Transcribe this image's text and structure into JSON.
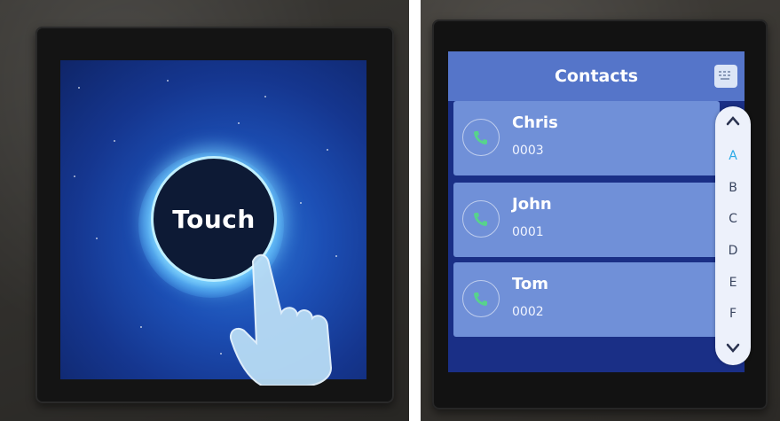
{
  "left_panel": {
    "touch_label": "Touch"
  },
  "right_panel": {
    "header": {
      "title": "Contacts",
      "keypad_icon": "keypad-icon"
    },
    "contacts": [
      {
        "name": "Chris",
        "number": "0003",
        "icon": "phone-icon"
      },
      {
        "name": "John",
        "number": "0001",
        "icon": "phone-icon"
      },
      {
        "name": "Tom",
        "number": "0002",
        "icon": "phone-icon"
      }
    ],
    "alpha_index": {
      "letters": [
        "A",
        "B",
        "C",
        "D",
        "E",
        "F"
      ],
      "active": "A",
      "up_icon": "chevron-up-icon",
      "down_icon": "chevron-down-icon"
    }
  },
  "colors": {
    "header_bar": "#5575c9",
    "contact_card": "#7090d8",
    "phone_icon": "#57d38c",
    "active_letter": "#29a9e6",
    "touch_glow": "#9fe4ff"
  }
}
